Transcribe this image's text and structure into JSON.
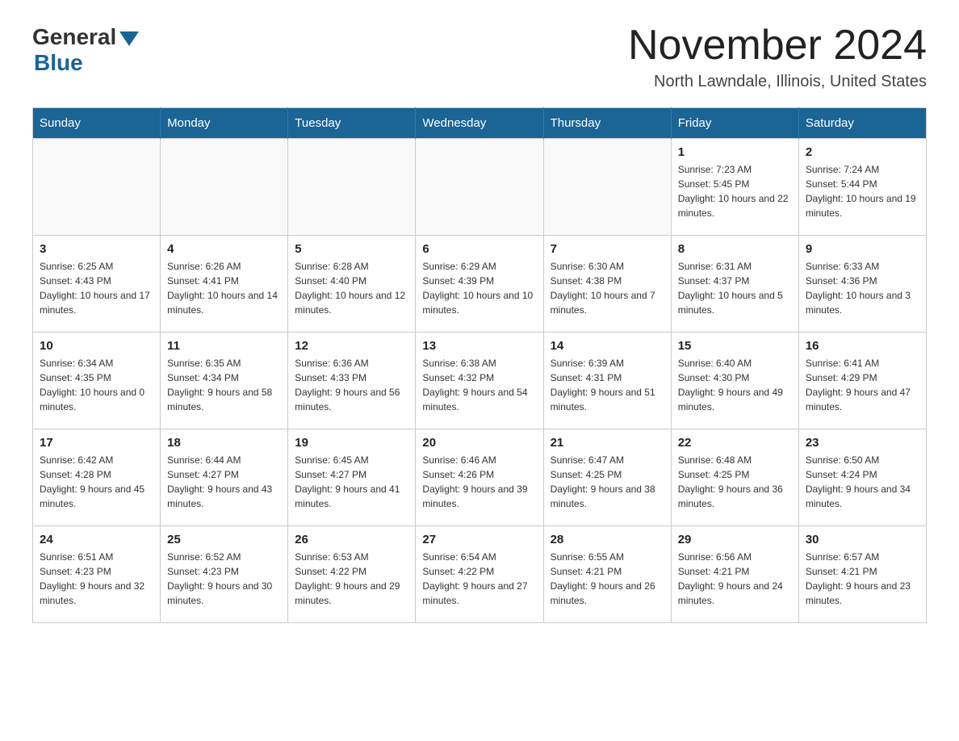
{
  "header": {
    "logo_general": "General",
    "logo_blue": "Blue",
    "month_title": "November 2024",
    "location": "North Lawndale, Illinois, United States"
  },
  "calendar": {
    "days_of_week": [
      "Sunday",
      "Monday",
      "Tuesday",
      "Wednesday",
      "Thursday",
      "Friday",
      "Saturday"
    ],
    "weeks": [
      [
        {
          "day": "",
          "info": ""
        },
        {
          "day": "",
          "info": ""
        },
        {
          "day": "",
          "info": ""
        },
        {
          "day": "",
          "info": ""
        },
        {
          "day": "",
          "info": ""
        },
        {
          "day": "1",
          "info": "Sunrise: 7:23 AM\nSunset: 5:45 PM\nDaylight: 10 hours and 22 minutes."
        },
        {
          "day": "2",
          "info": "Sunrise: 7:24 AM\nSunset: 5:44 PM\nDaylight: 10 hours and 19 minutes."
        }
      ],
      [
        {
          "day": "3",
          "info": "Sunrise: 6:25 AM\nSunset: 4:43 PM\nDaylight: 10 hours and 17 minutes."
        },
        {
          "day": "4",
          "info": "Sunrise: 6:26 AM\nSunset: 4:41 PM\nDaylight: 10 hours and 14 minutes."
        },
        {
          "day": "5",
          "info": "Sunrise: 6:28 AM\nSunset: 4:40 PM\nDaylight: 10 hours and 12 minutes."
        },
        {
          "day": "6",
          "info": "Sunrise: 6:29 AM\nSunset: 4:39 PM\nDaylight: 10 hours and 10 minutes."
        },
        {
          "day": "7",
          "info": "Sunrise: 6:30 AM\nSunset: 4:38 PM\nDaylight: 10 hours and 7 minutes."
        },
        {
          "day": "8",
          "info": "Sunrise: 6:31 AM\nSunset: 4:37 PM\nDaylight: 10 hours and 5 minutes."
        },
        {
          "day": "9",
          "info": "Sunrise: 6:33 AM\nSunset: 4:36 PM\nDaylight: 10 hours and 3 minutes."
        }
      ],
      [
        {
          "day": "10",
          "info": "Sunrise: 6:34 AM\nSunset: 4:35 PM\nDaylight: 10 hours and 0 minutes."
        },
        {
          "day": "11",
          "info": "Sunrise: 6:35 AM\nSunset: 4:34 PM\nDaylight: 9 hours and 58 minutes."
        },
        {
          "day": "12",
          "info": "Sunrise: 6:36 AM\nSunset: 4:33 PM\nDaylight: 9 hours and 56 minutes."
        },
        {
          "day": "13",
          "info": "Sunrise: 6:38 AM\nSunset: 4:32 PM\nDaylight: 9 hours and 54 minutes."
        },
        {
          "day": "14",
          "info": "Sunrise: 6:39 AM\nSunset: 4:31 PM\nDaylight: 9 hours and 51 minutes."
        },
        {
          "day": "15",
          "info": "Sunrise: 6:40 AM\nSunset: 4:30 PM\nDaylight: 9 hours and 49 minutes."
        },
        {
          "day": "16",
          "info": "Sunrise: 6:41 AM\nSunset: 4:29 PM\nDaylight: 9 hours and 47 minutes."
        }
      ],
      [
        {
          "day": "17",
          "info": "Sunrise: 6:42 AM\nSunset: 4:28 PM\nDaylight: 9 hours and 45 minutes."
        },
        {
          "day": "18",
          "info": "Sunrise: 6:44 AM\nSunset: 4:27 PM\nDaylight: 9 hours and 43 minutes."
        },
        {
          "day": "19",
          "info": "Sunrise: 6:45 AM\nSunset: 4:27 PM\nDaylight: 9 hours and 41 minutes."
        },
        {
          "day": "20",
          "info": "Sunrise: 6:46 AM\nSunset: 4:26 PM\nDaylight: 9 hours and 39 minutes."
        },
        {
          "day": "21",
          "info": "Sunrise: 6:47 AM\nSunset: 4:25 PM\nDaylight: 9 hours and 38 minutes."
        },
        {
          "day": "22",
          "info": "Sunrise: 6:48 AM\nSunset: 4:25 PM\nDaylight: 9 hours and 36 minutes."
        },
        {
          "day": "23",
          "info": "Sunrise: 6:50 AM\nSunset: 4:24 PM\nDaylight: 9 hours and 34 minutes."
        }
      ],
      [
        {
          "day": "24",
          "info": "Sunrise: 6:51 AM\nSunset: 4:23 PM\nDaylight: 9 hours and 32 minutes."
        },
        {
          "day": "25",
          "info": "Sunrise: 6:52 AM\nSunset: 4:23 PM\nDaylight: 9 hours and 30 minutes."
        },
        {
          "day": "26",
          "info": "Sunrise: 6:53 AM\nSunset: 4:22 PM\nDaylight: 9 hours and 29 minutes."
        },
        {
          "day": "27",
          "info": "Sunrise: 6:54 AM\nSunset: 4:22 PM\nDaylight: 9 hours and 27 minutes."
        },
        {
          "day": "28",
          "info": "Sunrise: 6:55 AM\nSunset: 4:21 PM\nDaylight: 9 hours and 26 minutes."
        },
        {
          "day": "29",
          "info": "Sunrise: 6:56 AM\nSunset: 4:21 PM\nDaylight: 9 hours and 24 minutes."
        },
        {
          "day": "30",
          "info": "Sunrise: 6:57 AM\nSunset: 4:21 PM\nDaylight: 9 hours and 23 minutes."
        }
      ]
    ]
  }
}
